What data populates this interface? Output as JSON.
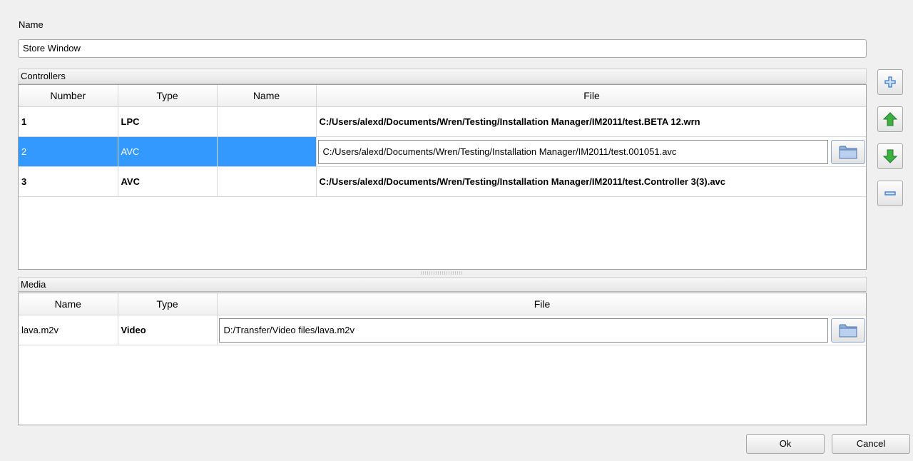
{
  "name_label": "Name",
  "name_value": "Store Window",
  "controllers": {
    "title": "Controllers",
    "columns": [
      "Number",
      "Type",
      "Name",
      "File"
    ],
    "rows": [
      {
        "number": "1",
        "type": "LPC",
        "name": "",
        "file": "C:/Users/alexd/Documents/Wren/Testing/Installation Manager/IM2011/test.BETA 12.wrn"
      },
      {
        "number": "2",
        "type": "AVC",
        "name": "",
        "file": "C:/Users/alexd/Documents/Wren/Testing/Installation Manager/IM2011/test.001051.avc"
      },
      {
        "number": "3",
        "type": "AVC",
        "name": "",
        "file": "C:/Users/alexd/Documents/Wren/Testing/Installation Manager/IM2011/test.Controller 3(3).avc"
      }
    ]
  },
  "media": {
    "title": "Media",
    "columns": [
      "Name",
      "Type",
      "File"
    ],
    "rows": [
      {
        "name": "lava.m2v",
        "type": "Video",
        "file": "D:/Transfer/Video files/lava.m2v"
      }
    ]
  },
  "icons": {
    "add": "plus-icon",
    "up": "arrow-up-icon",
    "down": "arrow-down-icon",
    "remove": "minus-icon",
    "browse": "folder-icon"
  },
  "colors": {
    "selection": "#3399ff",
    "arrow_green": "#3cb043",
    "icon_blue": "#3a78c9"
  },
  "buttons": {
    "ok": "Ok",
    "cancel": "Cancel"
  }
}
